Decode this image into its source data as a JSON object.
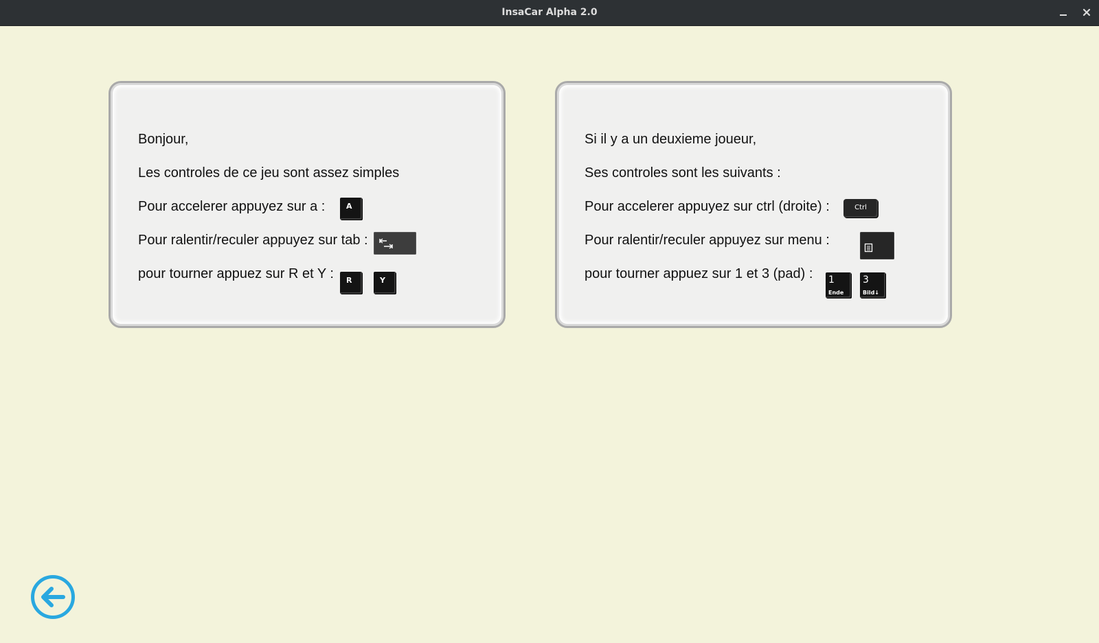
{
  "window": {
    "title": "InsaCar Alpha 2.0",
    "minimize_icon": "minimize-icon",
    "close_icon": "close-icon"
  },
  "player1": {
    "greeting": "Bonjour,",
    "intro": "Les controles de ce jeu sont assez simples",
    "accelerate": "Pour accelerer appuyez sur a :",
    "brake": "Pour ralentir/reculer appuyez sur tab :",
    "turn": "pour tourner appuez sur R et Y :",
    "keys": {
      "accelerate": "A",
      "turn_left": "R",
      "turn_right": "Y"
    }
  },
  "player2": {
    "greeting": "Si il y a un deuxieme joueur,",
    "intro": "Ses controles sont les suivants :",
    "accelerate": "Pour accelerer appuyez sur ctrl (droite) :",
    "brake": "Pour ralentir/reculer appuyez sur menu  :",
    "turn": "pour tourner appuez sur 1 et 3 (pad) :",
    "keys": {
      "accelerate": "Ctrl",
      "turn_left_num": "1",
      "turn_left_sub": "Ende",
      "turn_right_num": "3",
      "turn_right_sub": "Bild↓"
    }
  },
  "colors": {
    "background": "#f3f3db",
    "titlebar": "#2d3134",
    "back_button": "#29a8e0"
  },
  "back_icon": "arrow-left-circle-icon"
}
